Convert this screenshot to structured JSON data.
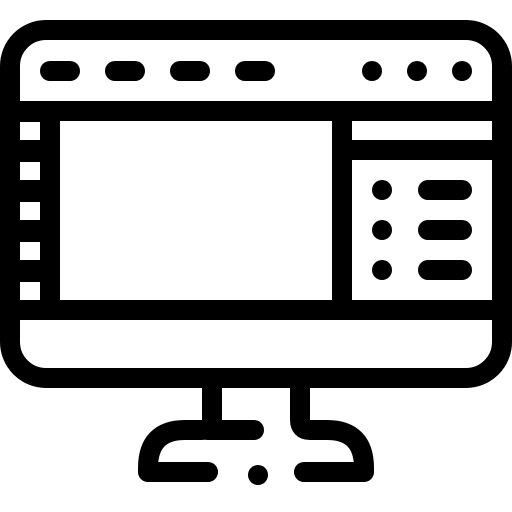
{
  "icon": {
    "name": "desktop-monitor-with-app-window",
    "stroke_color": "#000000",
    "fill_color": "#ffffff"
  },
  "window": {
    "toolbar_tabs": 4,
    "toolbar_dots": 3,
    "sidebar_squares": 5,
    "list_items": 3
  }
}
